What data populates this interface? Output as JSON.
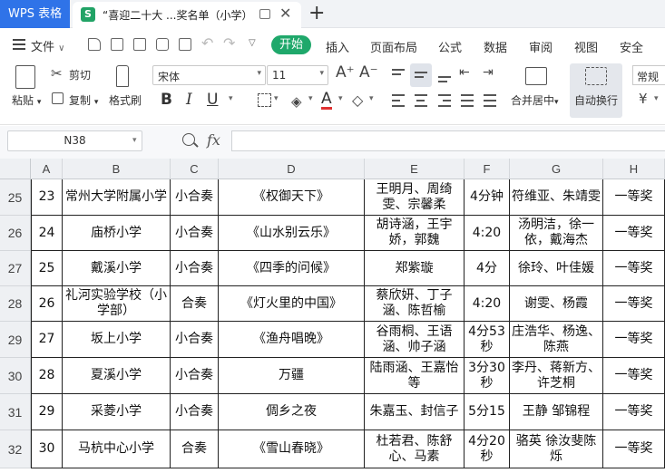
{
  "titlebar": {
    "app_name": "WPS 表格",
    "doc_icon_letter": "S",
    "doc_title": "“喜迎二十大 ...奖名单（小学）",
    "close_glyph": "✕",
    "new_tab_glyph": "+"
  },
  "menubar": {
    "file_label": "文件",
    "tabs": [
      "开始",
      "插入",
      "页面布局",
      "公式",
      "数据",
      "审阅",
      "视图",
      "安全"
    ]
  },
  "ribbon": {
    "paste_label": "粘贴",
    "cut_label": "剪切",
    "copy_label": "复制",
    "format_painter_label": "格式刷",
    "font_name": "宋体",
    "font_size": "11",
    "increase_font": "A⁺",
    "decrease_font": "A⁻",
    "bold": "B",
    "italic": "I",
    "underline": "U",
    "font_color_glyph": "A",
    "merge_label": "合并居中",
    "wrap_label": "自动换行",
    "number_format": "常规",
    "currency_glyph": "¥"
  },
  "formula_bar": {
    "cell_ref": "N38",
    "fx_label": "fx",
    "formula": ""
  },
  "sheet": {
    "columns": [
      "A",
      "B",
      "C",
      "D",
      "E",
      "F",
      "G",
      "H"
    ],
    "rows": [
      {
        "num": "25",
        "cells": [
          "23",
          "常州大学附属小学",
          "小合奏",
          "《权御天下》",
          "王明月、周绮雯、宗馨柔",
          "4分钟",
          "符维亚、朱靖雯",
          "一等奖"
        ]
      },
      {
        "num": "26",
        "cells": [
          "24",
          "庙桥小学",
          "小合奏",
          "《山水别云乐》",
          "胡诗涵，王宇娇，郭魏",
          "4:20",
          "汤明洁，徐一依，戴海杰",
          "一等奖"
        ]
      },
      {
        "num": "27",
        "cells": [
          "25",
          "戴溪小学",
          "小合奏",
          "《四季的问候》",
          "郑紫璇",
          "4分",
          "徐玲、叶佳媛",
          "一等奖"
        ]
      },
      {
        "num": "28",
        "cells": [
          "26",
          "礼河实验学校（小学部）",
          "合奏",
          "《灯火里的中国》",
          "蔡欣妍、丁子涵、陈哲榆",
          "4:20",
          "谢雯、杨霞",
          "一等奖"
        ]
      },
      {
        "num": "29",
        "cells": [
          "27",
          "坂上小学",
          "小合奏",
          "《渔舟唱晚》",
          "谷雨桐、王语涵、帅子涵",
          "4分53秒",
          "庄浩华、杨逸、陈燕",
          "一等奖"
        ]
      },
      {
        "num": "30",
        "cells": [
          "28",
          "夏溪小学",
          "小合奏",
          "万疆",
          "陆雨涵、王嘉怡等",
          "3分30秒",
          "李丹、蒋新方、许芝桐",
          "一等奖"
        ]
      },
      {
        "num": "31",
        "cells": [
          "29",
          "采菱小学",
          "小合奏",
          "倜乡之夜",
          "朱嘉玉、封信子",
          "5分15",
          "王静 邹锦程",
          "一等奖"
        ]
      },
      {
        "num": "32",
        "cells": [
          "30",
          "马杭中心小学",
          "合奏",
          "《雪山春晓》",
          "杜若君、陈舒心、马素",
          "4分20秒",
          "骆英 徐汝斐陈烁",
          "一等奖"
        ]
      }
    ]
  }
}
